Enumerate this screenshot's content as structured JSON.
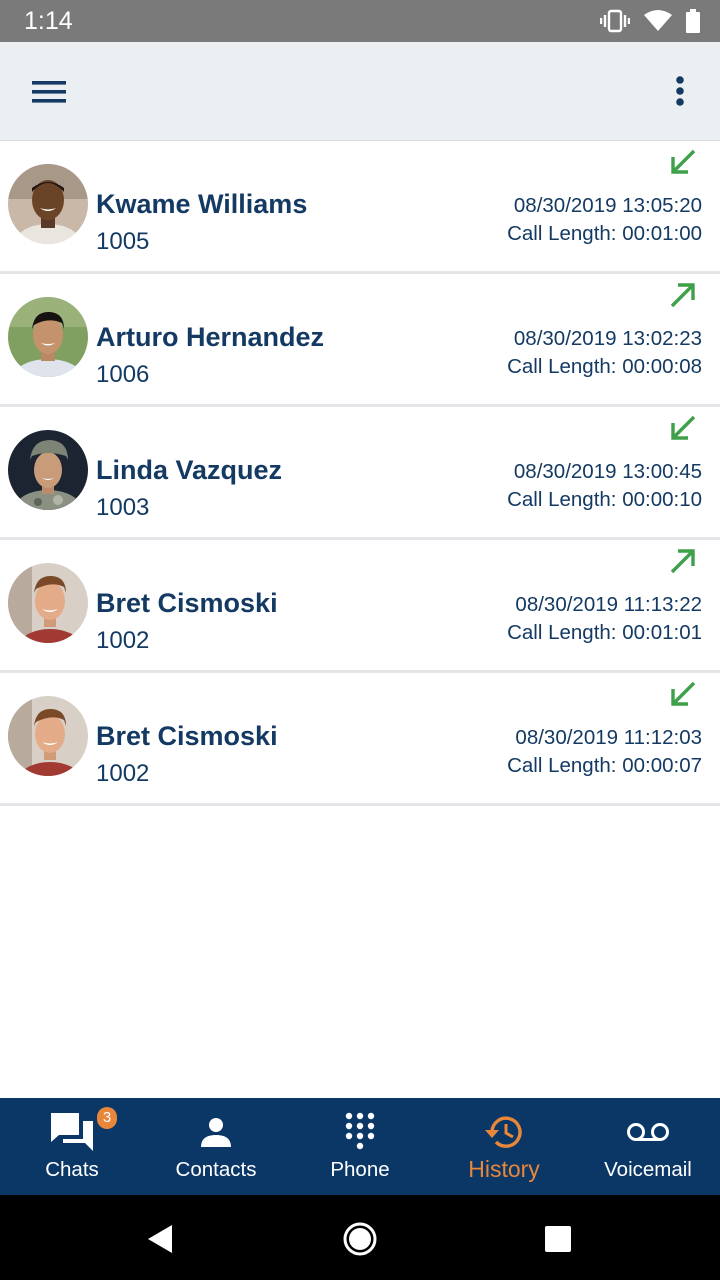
{
  "status_bar": {
    "time": "1:14",
    "icons": [
      "vibrate-icon",
      "wifi-icon",
      "battery-icon"
    ]
  },
  "app_bar": {
    "menu_icon": "hamburger-menu-icon",
    "more_icon": "more-vert-icon"
  },
  "history": [
    {
      "name": "Kwame Williams",
      "extension": "1005",
      "datetime": "08/30/2019 13:05:20",
      "call_length": "Call Length: 00:01:00",
      "direction": "incoming"
    },
    {
      "name": "Arturo Hernandez",
      "extension": "1006",
      "datetime": "08/30/2019 13:02:23",
      "call_length": "Call Length: 00:00:08",
      "direction": "outgoing"
    },
    {
      "name": "Linda Vazquez",
      "extension": "1003",
      "datetime": "08/30/2019 13:00:45",
      "call_length": "Call Length: 00:00:10",
      "direction": "incoming"
    },
    {
      "name": "Bret Cismoski",
      "extension": "1002",
      "datetime": "08/30/2019 11:13:22",
      "call_length": "Call Length: 00:01:01",
      "direction": "outgoing"
    },
    {
      "name": "Bret Cismoski",
      "extension": "1002",
      "datetime": "08/30/2019 11:12:03",
      "call_length": "Call Length: 00:00:07",
      "direction": "incoming"
    }
  ],
  "bottom_nav": {
    "items": [
      {
        "label": "Chats",
        "icon": "chats-icon",
        "badge": "3"
      },
      {
        "label": "Contacts",
        "icon": "person-icon"
      },
      {
        "label": "Phone",
        "icon": "dialpad-icon"
      },
      {
        "label": "History",
        "icon": "history-icon",
        "active": true
      },
      {
        "label": "Voicemail",
        "icon": "voicemail-icon"
      }
    ]
  },
  "colors": {
    "brand_navy": "#0b3766",
    "text_navy": "#143a63",
    "accent_orange": "#e8863a",
    "call_green": "#3fa04a"
  }
}
